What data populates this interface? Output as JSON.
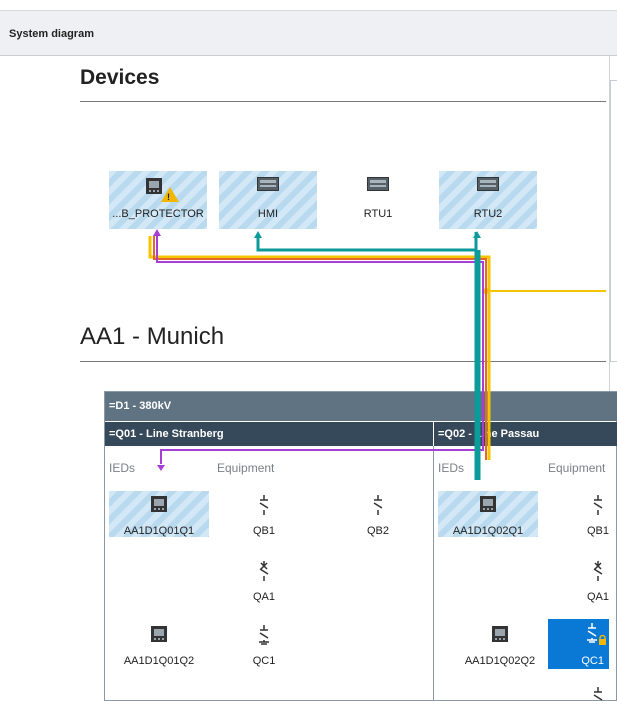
{
  "window": {
    "title": "System diagram"
  },
  "sections": {
    "devices": "Devices",
    "substation": "AA1 - Munich"
  },
  "devices": [
    {
      "label": "...B_PROTECTOR",
      "icon": "ied-icon",
      "warning": true
    },
    {
      "label": "HMI",
      "icon": "computer-icon"
    },
    {
      "label": "RTU1",
      "icon": "computer-icon"
    },
    {
      "label": "RTU2",
      "icon": "computer-icon"
    }
  ],
  "voltage_level": "=D1 - 380kV",
  "bays": [
    {
      "name": "=Q01 - Line Stranberg",
      "ieds_header": "IEDs",
      "equipment_header": "Equipment",
      "ieds": [
        "AA1D1Q01Q1",
        "AA1D1Q01Q2"
      ],
      "equipment": [
        "QB1",
        "QB2",
        "QA1",
        "QC1"
      ]
    },
    {
      "name": "=Q02 - Line Passau",
      "ieds_header": "IEDs",
      "equipment_header": "Equipment",
      "ieds": [
        "AA1D1Q02Q1",
        "AA1D1Q02Q2"
      ],
      "equipment": [
        "QB1",
        "QA1",
        "QC1"
      ],
      "selected_equipment": "QC1"
    }
  ],
  "colors": {
    "teal": "#0b9b9b",
    "yellow": "#f5c400",
    "magenta": "#a63fd6",
    "orange": "#e8652d",
    "selection": "#0a79d6"
  }
}
